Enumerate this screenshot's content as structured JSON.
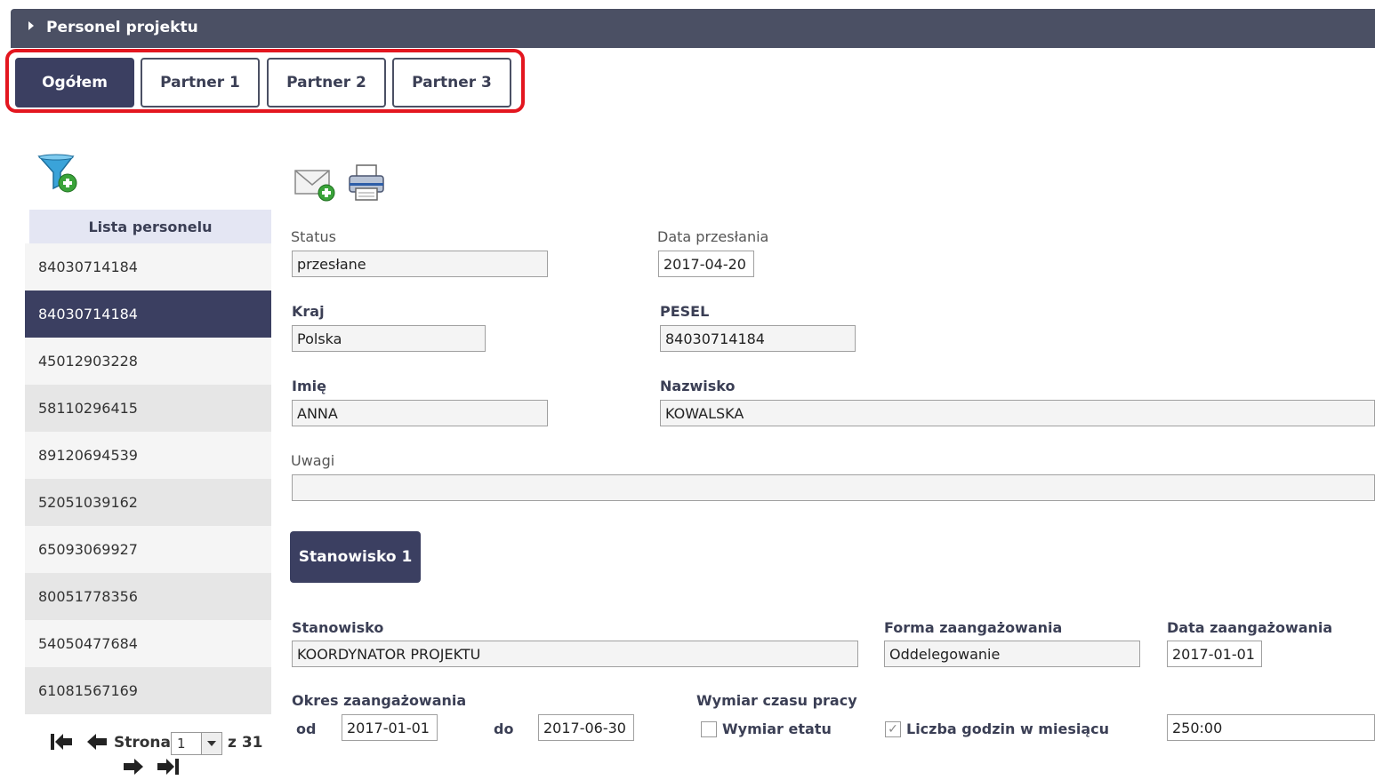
{
  "header": {
    "title": "Personel projektu"
  },
  "tabs": [
    {
      "label": "Ogółem",
      "active": true
    },
    {
      "label": "Partner 1",
      "active": false
    },
    {
      "label": "Partner 2",
      "active": false
    },
    {
      "label": "Partner 3",
      "active": false
    }
  ],
  "toolbar": {
    "filter_icon": "filter-add-icon",
    "email_icon": "email-add-icon",
    "print_icon": "print-icon"
  },
  "list": {
    "header": "Lista personelu",
    "items": [
      "84030714184",
      "84030714184",
      "45012903228",
      "58110296415",
      "89120694539",
      "52051039162",
      "65093069927",
      "80051778356",
      "54050477684",
      "61081567169"
    ],
    "selected_index": 1
  },
  "pager": {
    "label": "Strona",
    "page": "1",
    "of": "z 31"
  },
  "form": {
    "status_label": "Status",
    "status_value": "przesłane",
    "data_przeslania_label": "Data przesłania",
    "data_przeslania_value": "2017-04-20",
    "kraj_label": "Kraj",
    "kraj_value": "Polska",
    "pesel_label": "PESEL",
    "pesel_value": "84030714184",
    "imie_label": "Imię",
    "imie_value": "ANNA",
    "nazwisko_label": "Nazwisko",
    "nazwisko_value": "KOWALSKA",
    "uwagi_label": "Uwagi",
    "uwagi_value": ""
  },
  "position": {
    "button_label": "Stanowisko 1",
    "stanowisko_label": "Stanowisko",
    "stanowisko_value": "KOORDYNATOR PROJEKTU",
    "forma_label": "Forma zaangażowania",
    "forma_value": "Oddelegowanie",
    "data_zaang_label": "Data zaangażowania",
    "data_zaang_value": "2017-01-01",
    "okres_label": "Okres zaangażowania",
    "od_label": "od",
    "od_value": "2017-01-01",
    "do_label": "do",
    "do_value": "2017-06-30",
    "wymiar_label": "Wymiar czasu pracy",
    "wymiar_etatu_label": "Wymiar etatu",
    "wymiar_etatu_checked": false,
    "liczba_godzin_label": "Liczba godzin w miesiącu",
    "liczba_godzin_checked": true,
    "godziny_value": "250:00"
  }
}
